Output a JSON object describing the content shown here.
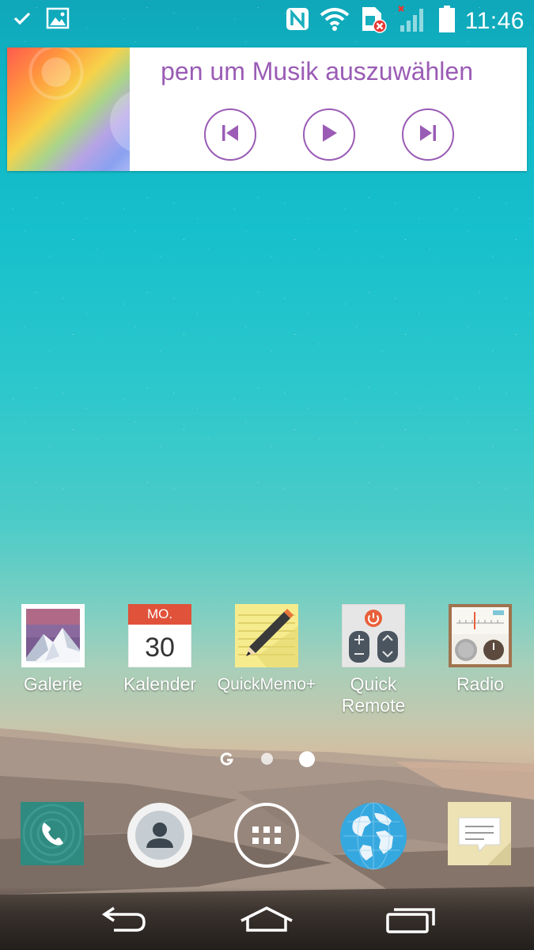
{
  "status_bar": {
    "time": "11:46",
    "left_icons": [
      "check-icon",
      "image-icon"
    ],
    "right_icons": [
      "nfc-icon",
      "wifi-icon",
      "sim-error-icon",
      "signal-icon",
      "battery-icon"
    ]
  },
  "music_widget": {
    "title": "pen um Musik auszuwählen",
    "accent_color": "#9a5cb5",
    "controls": [
      "previous-icon",
      "play-icon",
      "next-icon"
    ]
  },
  "apps": [
    {
      "label": "Galerie",
      "icon": "gallery-icon"
    },
    {
      "label": "Kalender",
      "icon": "calendar-icon",
      "calendar_day": "MO.",
      "calendar_date": "30"
    },
    {
      "label": "QuickMemo+",
      "icon": "quickmemo-icon"
    },
    {
      "label": "Quick\nRemote",
      "icon": "remote-icon"
    },
    {
      "label": "Radio",
      "icon": "radio-icon"
    }
  ],
  "pager": {
    "pages": 3,
    "active_index": 2,
    "first_icon": "google-g-icon"
  },
  "dock": [
    "phone-icon",
    "contacts-icon",
    "app-drawer-icon",
    "browser-globe-icon",
    "messages-icon"
  ],
  "nav_bar": [
    "back-icon",
    "home-icon",
    "recent-apps-icon"
  ]
}
